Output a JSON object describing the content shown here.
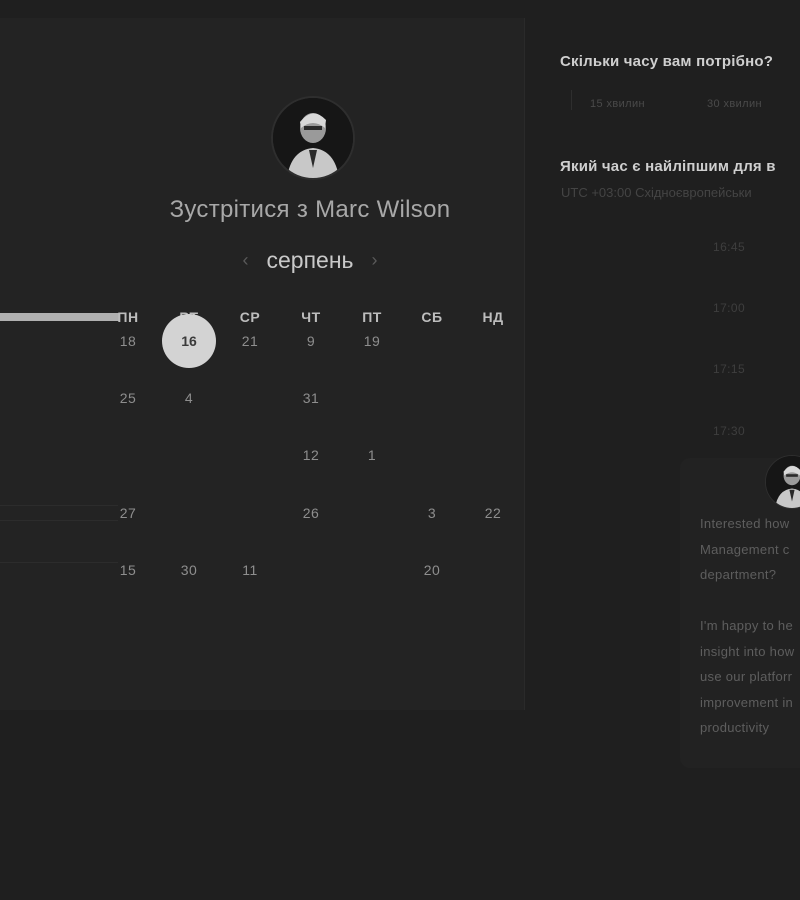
{
  "organizer": {
    "title": "Зустрітися з Marc Wilson",
    "avatar_icon": "person-avatar-icon"
  },
  "calendar": {
    "month": "серпень",
    "prev_icon": "chevron-left-icon",
    "next_icon": "chevron-right-icon",
    "progress_fraction": 0.23,
    "weekdays": [
      "ПН",
      "ВТ",
      "СР",
      "ЧТ",
      "ПТ",
      "СБ",
      "НД"
    ],
    "selected_day": "16",
    "rows": [
      [
        "18",
        "16",
        "21",
        "9",
        "19",
        "",
        ""
      ],
      [
        "25",
        "4",
        "",
        "31",
        "",
        "",
        ""
      ],
      [
        "",
        "",
        "",
        "12",
        "1",
        "",
        ""
      ],
      [
        "27",
        "",
        "",
        "26",
        "",
        "3",
        "22"
      ],
      [
        "15",
        "30",
        "11",
        "",
        "",
        "20",
        ""
      ]
    ]
  },
  "duration": {
    "question": "Скільки часу вам потрібно?",
    "options": [
      "15 хвилин",
      "30 хвилин"
    ]
  },
  "time": {
    "question": "Який час є найліпшим для в",
    "timezone": "UTC +03:00 Східноєвропейськи",
    "slots": [
      "16:45",
      "17:00",
      "17:15",
      "17:30"
    ]
  },
  "message": {
    "lines": [
      "Interested how",
      "Management c",
      "department?",
      "",
      "I'm happy to he",
      "insight into how",
      "use our platforr",
      "improvement in",
      "productivity"
    ]
  }
}
